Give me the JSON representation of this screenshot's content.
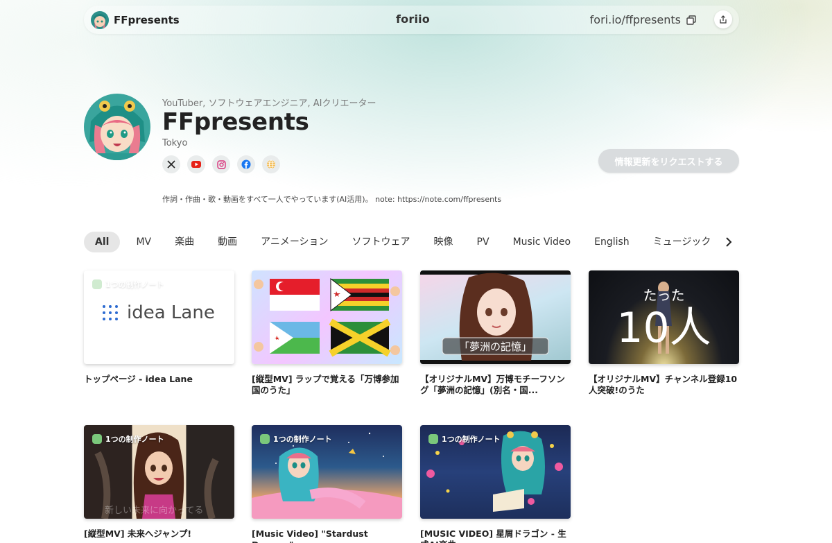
{
  "topbar": {
    "brand": "FFpresents",
    "logo": "foriio",
    "url": "fori.io/ffpresents",
    "icons": {
      "copy": "copy-icon",
      "share": "share-icon"
    }
  },
  "profile": {
    "tagline": "YouTuber, ソフトウェアエンジニア, AIクリエーター",
    "name": "FFpresents",
    "location": "Tokyo",
    "bio": "作詞・作曲・歌・動画をすべて一人でやっています(AI活用)。 note: https://note.com/ffpresents",
    "request_button": "情報更新をリクエストする",
    "socials": [
      "x-icon",
      "youtube-icon",
      "instagram-icon",
      "facebook-icon",
      "globe-icon"
    ]
  },
  "tabs": [
    "All",
    "MV",
    "楽曲",
    "動画",
    "アニメーション",
    "ソフトウェア",
    "映像",
    "PV",
    "Music Video",
    "English",
    "ミュージック"
  ],
  "cards": [
    {
      "title": "トップページ - idea Lane",
      "badge": "1つの制作ノート",
      "thumb_text": "idea Lane"
    },
    {
      "title": "[縦型MV] ラップで覚える「万博参加国のうた」",
      "badge": "",
      "thumb_text": ""
    },
    {
      "title": "【オリジナルMV】万博モチーフソング「夢洲の記憶」(別名・国...",
      "badge": "",
      "thumb_text": "「夢洲の記憶」"
    },
    {
      "title": "【オリジナルMV】チャンネル登録10人突破!のうた",
      "badge": "",
      "thumb_text_top": "たった",
      "thumb_text_big": "10人"
    },
    {
      "title": "[縦型MV] 未来へジャンプ!",
      "badge": "1つの制作ノート",
      "thumb_text": "新しい未来に向かってる"
    },
    {
      "title": "[Music Video] \"Stardust Dreams\"",
      "badge": "1つの制作ノート",
      "thumb_text": ""
    },
    {
      "title": "[MUSIC VIDEO] 星屑ドラゴン - 生成AI楽曲",
      "badge": "1つの制作ノート",
      "thumb_text": ""
    }
  ],
  "colors": {
    "accent": "#8fcdc3",
    "button_disabled": "#d9dcde",
    "badge_green": "#7bc87b"
  }
}
